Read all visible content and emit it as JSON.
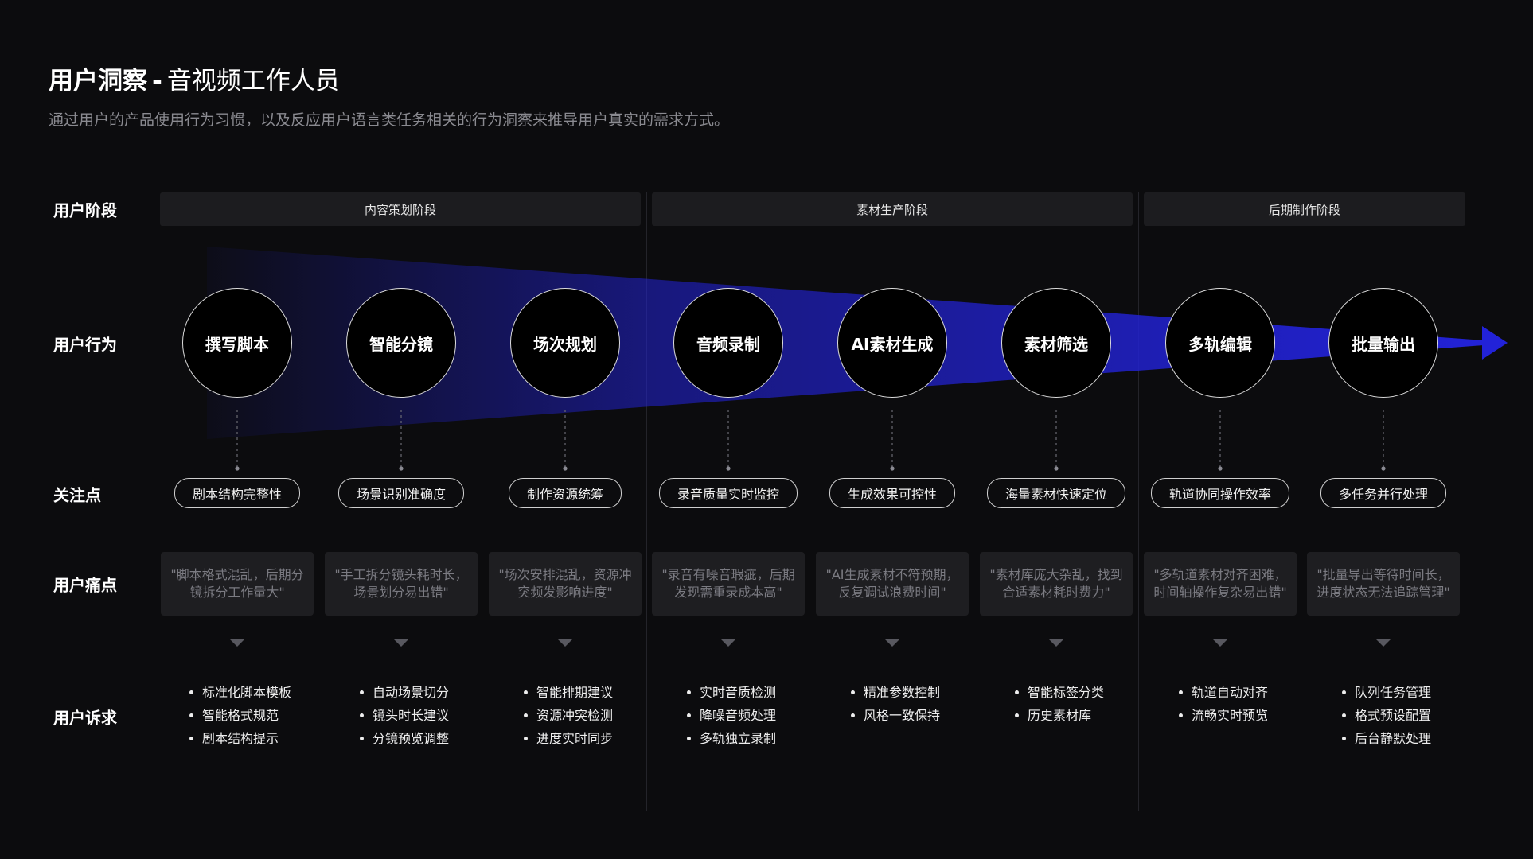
{
  "header": {
    "title_main": "用户洞察",
    "title_sep": "-",
    "title_sub": "音视频工作人员",
    "subtitle": "通过用户的产品使用行为习惯，以及反应用户语言类任务相关的行为洞察来推导用户真实的需求方式。"
  },
  "row_labels": {
    "stage": "用户阶段",
    "behavior": "用户行为",
    "focus": "关注点",
    "pain": "用户痛点",
    "needs": "用户诉求"
  },
  "stages": [
    "内容策划阶段",
    "素材生产阶段",
    "后期制作阶段"
  ],
  "behaviors": [
    "撰写脚本",
    "智能分镜",
    "场次规划",
    "音频录制",
    "AI素材生成",
    "素材筛选",
    "多轨编辑",
    "批量输出"
  ],
  "focus_points": [
    "剧本结构完整性",
    "场景识别准确度",
    "制作资源统筹",
    "录音质量实时监控",
    "生成效果可控性",
    "海量素材快速定位",
    "轨道协同操作效率",
    "多任务并行处理"
  ],
  "pain_points": [
    [
      "\"脚本格式混乱，后期分",
      "镜拆分工作量大\""
    ],
    [
      "\"手工拆分镜头耗时长，",
      "场景划分易出错\""
    ],
    [
      "\"场次安排混乱，资源冲",
      "突频发影响进度\""
    ],
    [
      "\"录音有噪音瑕疵，后期",
      "发现需重录成本高\""
    ],
    [
      "\"AI生成素材不符预期，",
      "反复调试浪费时间\""
    ],
    [
      "\"素材库庞大杂乱，找到",
      "合适素材耗时费力\""
    ],
    [
      "\"多轨道素材对齐困难，",
      "时间轴操作复杂易出错\""
    ],
    [
      "\"批量导出等待时间长，",
      "进度状态无法追踪管理\""
    ]
  ],
  "needs": [
    [
      "标准化脚本模板",
      "智能格式规范",
      "剧本结构提示"
    ],
    [
      "自动场景切分",
      "镜头时长建议",
      "分镜预览调整"
    ],
    [
      "智能排期建议",
      "资源冲突检测",
      "进度实时同步"
    ],
    [
      "实时音质检测",
      "降噪音频处理",
      "多轨独立录制"
    ],
    [
      "精准参数控制",
      "风格一致保持"
    ],
    [
      "智能标签分类",
      "历史素材库"
    ],
    [
      "轨道自动对齐",
      "流畅实时预览"
    ],
    [
      "队列任务管理",
      "格式预设配置",
      "后台静默处理"
    ]
  ],
  "colors": {
    "background": "#0c0c0e",
    "flow_accent": "#2222d8",
    "card": "#1e1e21",
    "stage_header": "#1c1c1f"
  },
  "icons": {
    "flow_arrow": "arrow-right-icon",
    "pain_to_need": "caret-down-icon"
  }
}
